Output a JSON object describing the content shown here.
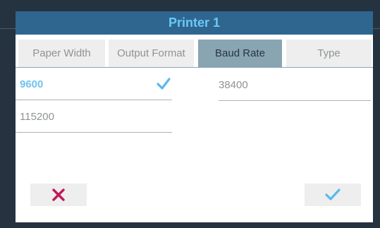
{
  "dialog": {
    "title": "Printer 1"
  },
  "tabs": [
    {
      "label": "Paper Width",
      "active": false
    },
    {
      "label": "Output Format",
      "active": false
    },
    {
      "label": "Baud Rate",
      "active": true
    },
    {
      "label": "Type",
      "active": false
    }
  ],
  "options": [
    {
      "label": "9600",
      "selected": true
    },
    {
      "label": "38400",
      "selected": false
    },
    {
      "label": "115200",
      "selected": false
    }
  ],
  "buttons": {
    "cancel_icon": "close-icon",
    "confirm_icon": "check-icon"
  },
  "colors": {
    "title_bar": "#2e6690",
    "title_text": "#6cc8f5",
    "active_tab": "#8aa5b2",
    "selected_text": "#6ec3f0",
    "cancel_icon": "#c2185b",
    "confirm_icon": "#5bb8ec"
  }
}
